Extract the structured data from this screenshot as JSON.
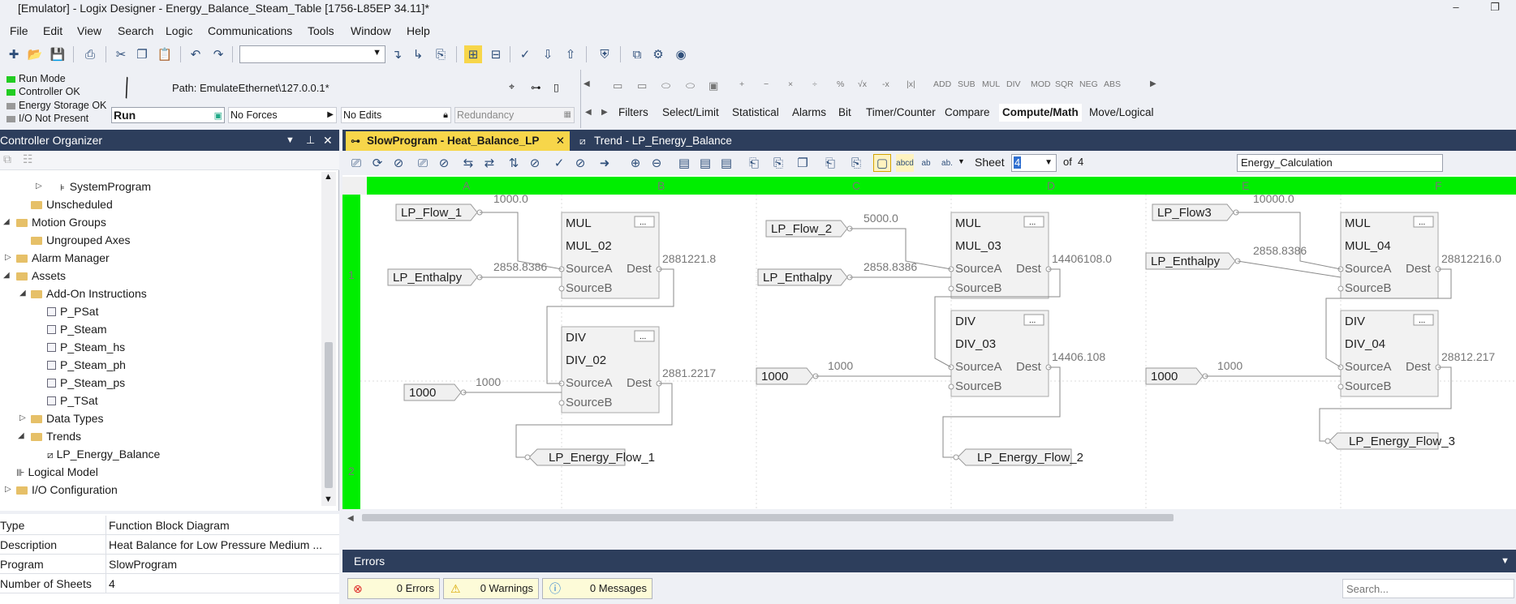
{
  "window": {
    "title": "[Emulator] - Logix Designer - Energy_Balance_Steam_Table [1756-L85EP 34.11]*",
    "minimize": "–",
    "restore": "❐"
  },
  "menu": [
    "File",
    "Edit",
    "View",
    "Search",
    "Logic",
    "Communications",
    "Tools",
    "Window",
    "Help"
  ],
  "status": {
    "run_mode": "Run Mode",
    "controller_ok": "Controller OK",
    "energy_storage_ok": "Energy Storage OK",
    "io_not_present": "I/O Not Present",
    "mode_value": "Run",
    "forces": "No Forces",
    "edits": "No Edits",
    "redundancy": "Redundancy",
    "path_label": "Path: EmulateEthernet\\127.0.0.1*"
  },
  "instruction_icons": [
    "ADD",
    "SUB",
    "MUL",
    "DIV",
    "MOD",
    "SQR",
    "NEG",
    "ABS"
  ],
  "instruction_tabs": [
    "Filters",
    "Select/Limit",
    "Statistical",
    "Alarms",
    "Bit",
    "Timer/Counter",
    "Compare",
    "Compute/Math",
    "Move/Logical"
  ],
  "organizer": {
    "title": "Controller Organizer",
    "items": [
      {
        "label": "SystemProgram",
        "indent": 3,
        "icon": "program"
      },
      {
        "label": "Unscheduled",
        "indent": 2,
        "icon": "folder"
      },
      {
        "label": "Motion Groups",
        "indent": 1,
        "icon": "folder"
      },
      {
        "label": "Ungrouped Axes",
        "indent": 2,
        "icon": "folder"
      },
      {
        "label": "Alarm Manager",
        "indent": 1,
        "icon": "folder"
      },
      {
        "label": "Assets",
        "indent": 1,
        "icon": "folder"
      },
      {
        "label": "Add-On Instructions",
        "indent": 2,
        "icon": "folder"
      },
      {
        "label": "P_PSat",
        "indent": 3,
        "icon": "aoi"
      },
      {
        "label": "P_Steam",
        "indent": 3,
        "icon": "aoi"
      },
      {
        "label": "P_Steam_hs",
        "indent": 3,
        "icon": "aoi"
      },
      {
        "label": "P_Steam_ph",
        "indent": 3,
        "icon": "aoi"
      },
      {
        "label": "P_Steam_ps",
        "indent": 3,
        "icon": "aoi"
      },
      {
        "label": "P_TSat",
        "indent": 3,
        "icon": "aoi"
      },
      {
        "label": "Data Types",
        "indent": 2,
        "icon": "folder"
      },
      {
        "label": "Trends",
        "indent": 2,
        "icon": "folder"
      },
      {
        "label": "LP_Energy_Balance",
        "indent": 3,
        "icon": "trend"
      },
      {
        "label": "Logical Model",
        "indent": 1,
        "icon": "model"
      },
      {
        "label": "I/O Configuration",
        "indent": 0,
        "icon": "folder"
      }
    ]
  },
  "properties": [
    {
      "key": "Type",
      "value": "Function Block Diagram"
    },
    {
      "key": "Description",
      "value": "Heat Balance for Low Pressure Medium ..."
    },
    {
      "key": "Program",
      "value": "SlowProgram"
    },
    {
      "key": "Number of Sheets",
      "value": "4"
    }
  ],
  "tabs": {
    "active": "SlowProgram - Heat_Balance_LP",
    "inactive": "Trend - LP_Energy_Balance",
    "close": "✕"
  },
  "sheet": {
    "label": "Sheet",
    "current": "4",
    "of": "of",
    "total": "4",
    "name": "Energy_Calculation"
  },
  "grid": {
    "cols": [
      "A",
      "B",
      "C",
      "D",
      "E",
      "F"
    ],
    "rows": [
      "1",
      "2"
    ]
  },
  "fbd": {
    "input_refs": [
      {
        "tag": "LP_Flow_1",
        "value": "1000.0"
      },
      {
        "tag": "LP_Enthalpy",
        "value": "2858.8386"
      },
      {
        "tag": "1000",
        "value": "1000"
      },
      {
        "tag": "LP_Flow_2",
        "value": "5000.0"
      },
      {
        "tag": "LP_Enthalpy",
        "value": "2858.8386"
      },
      {
        "tag": "1000",
        "value": "1000"
      },
      {
        "tag": "LP_Flow3",
        "value": "10000.0"
      },
      {
        "tag": "LP_Enthalpy",
        "value": "2858.8386"
      },
      {
        "tag": "1000",
        "value": "1000"
      }
    ],
    "blocks": [
      {
        "type": "MUL",
        "name": "MUL_02",
        "pin_a": "SourceA",
        "pin_b": "SourceB",
        "pin_out": "Dest",
        "dest_value": "2881221.8"
      },
      {
        "type": "DIV",
        "name": "DIV_02",
        "pin_a": "SourceA",
        "pin_b": "SourceB",
        "pin_out": "Dest",
        "dest_value": "2881.2217"
      },
      {
        "type": "MUL",
        "name": "MUL_03",
        "pin_a": "SourceA",
        "pin_b": "SourceB",
        "pin_out": "Dest",
        "dest_value": "14406108.0"
      },
      {
        "type": "DIV",
        "name": "DIV_03",
        "pin_a": "SourceA",
        "pin_b": "SourceB",
        "pin_out": "Dest",
        "dest_value": "14406.108"
      },
      {
        "type": "MUL",
        "name": "MUL_04",
        "pin_a": "SourceA",
        "pin_b": "SourceB",
        "pin_out": "Dest",
        "dest_value": "28812216.0"
      },
      {
        "type": "DIV",
        "name": "DIV_04",
        "pin_a": "SourceA",
        "pin_b": "SourceB",
        "pin_out": "Dest",
        "dest_value": "28812.217"
      }
    ],
    "output_refs": [
      "LP_Energy_Flow_1",
      "LP_Energy_Flow_2",
      "LP_Energy_Flow_3"
    ],
    "ellipsis": "..."
  },
  "errors": {
    "title": "Errors",
    "errors_count": "0 Errors",
    "warnings_count": "0 Warnings",
    "messages_count": "0 Messages",
    "search_placeholder": "Search..."
  },
  "colors": {
    "grid_header": "#00ee00",
    "title_bar": "#2d3e5c",
    "active_tab": "#f7d64a"
  }
}
